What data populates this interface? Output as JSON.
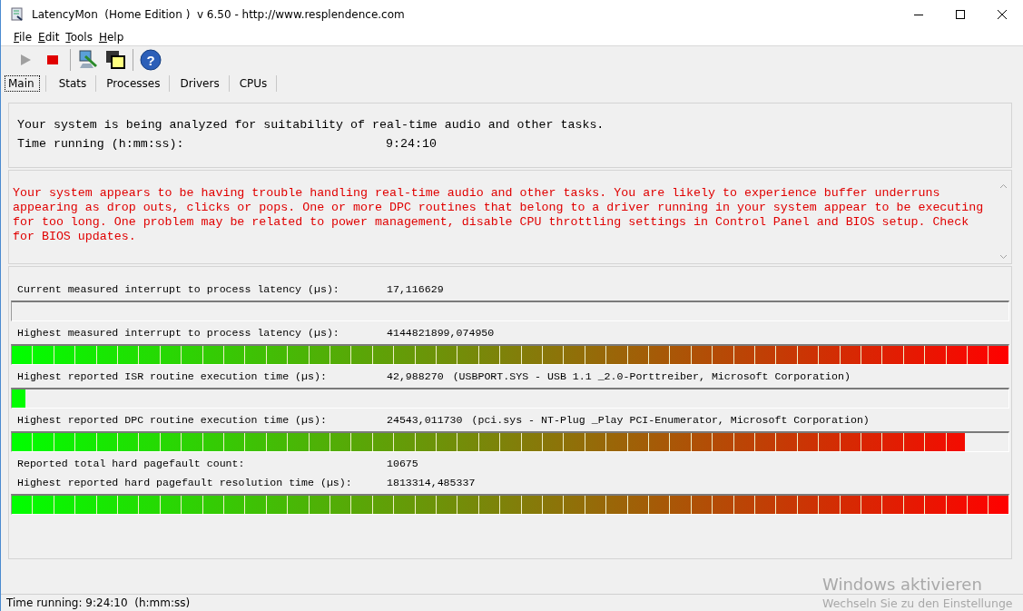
{
  "window": {
    "title": "LatencyMon  (Home Edition )  v 6.50 - http://www.resplendence.com"
  },
  "menu": [
    {
      "label": "File"
    },
    {
      "label": "Edit"
    },
    {
      "label": "Tools"
    },
    {
      "label": "Help"
    }
  ],
  "toolbar": [
    {
      "kind": "play",
      "disabled": true
    },
    {
      "kind": "stop",
      "disabled": false
    },
    {
      "kind": "separator"
    },
    {
      "kind": "monitor"
    },
    {
      "kind": "windows"
    },
    {
      "kind": "separator"
    },
    {
      "kind": "help",
      "glyph": "?"
    }
  ],
  "tabs": [
    {
      "label": "Main",
      "selected": true
    },
    {
      "label": "Stats",
      "selected": false
    },
    {
      "label": "Processes",
      "selected": false
    },
    {
      "label": "Drivers",
      "selected": false
    },
    {
      "label": "CPUs",
      "selected": false
    }
  ],
  "summary": {
    "status": "Your system is being analyzed for suitability of real-time audio and other tasks.",
    "time_label": "Time running (h:mm:ss):",
    "time_value": "9:24:10"
  },
  "verdict": "Your system appears to be having trouble handling real-time audio and other tasks. You are likely to experience buffer underruns appearing as drop outs, clicks or pops. One or more DPC routines that belong to a driver running in your system appear to be executing for too long. One problem may be related to power management, disable CPU throttling settings in Control Panel and BIOS setup. Check for BIOS updates.",
  "measurements": [
    {
      "kind": "reading",
      "label": "Current measured interrupt to process latency (µs):",
      "value": "17,116629"
    },
    {
      "kind": "meter",
      "level": 0
    },
    {
      "kind": "reading",
      "label": "Highest measured interrupt to process latency (µs):",
      "value": "4144821899,074950"
    },
    {
      "kind": "meter",
      "level": 1
    },
    {
      "kind": "reading",
      "label": "Highest reported ISR routine execution time (µs):",
      "value": "42,988270",
      "detail": "(USBPORT.SYS - USB 1.1 _2.0-Porttreiber, Microsoft Corporation)"
    },
    {
      "kind": "meter",
      "level": 0.014
    },
    {
      "kind": "reading",
      "label": "Highest reported DPC routine execution time (µs):",
      "value": "24543,011730",
      "detail": "(pci.sys - NT-Plug _Play PCI-Enumerator, Microsoft Corporation)"
    },
    {
      "kind": "meter",
      "level": 0.956
    },
    {
      "kind": "reading",
      "label": "Reported total hard pagefault count:",
      "value": "10675"
    },
    {
      "kind": "reading",
      "label": "Highest reported hard pagefault resolution time (µs):",
      "value": "1813314,485337"
    },
    {
      "kind": "meter",
      "level": 1
    }
  ],
  "status_bar": "Time running: 9:24:10  (h:mm:ss)",
  "activation_notice": {
    "title": "Windows aktivieren",
    "subtitle": "Wechseln Sie zu den Einstellunge"
  }
}
